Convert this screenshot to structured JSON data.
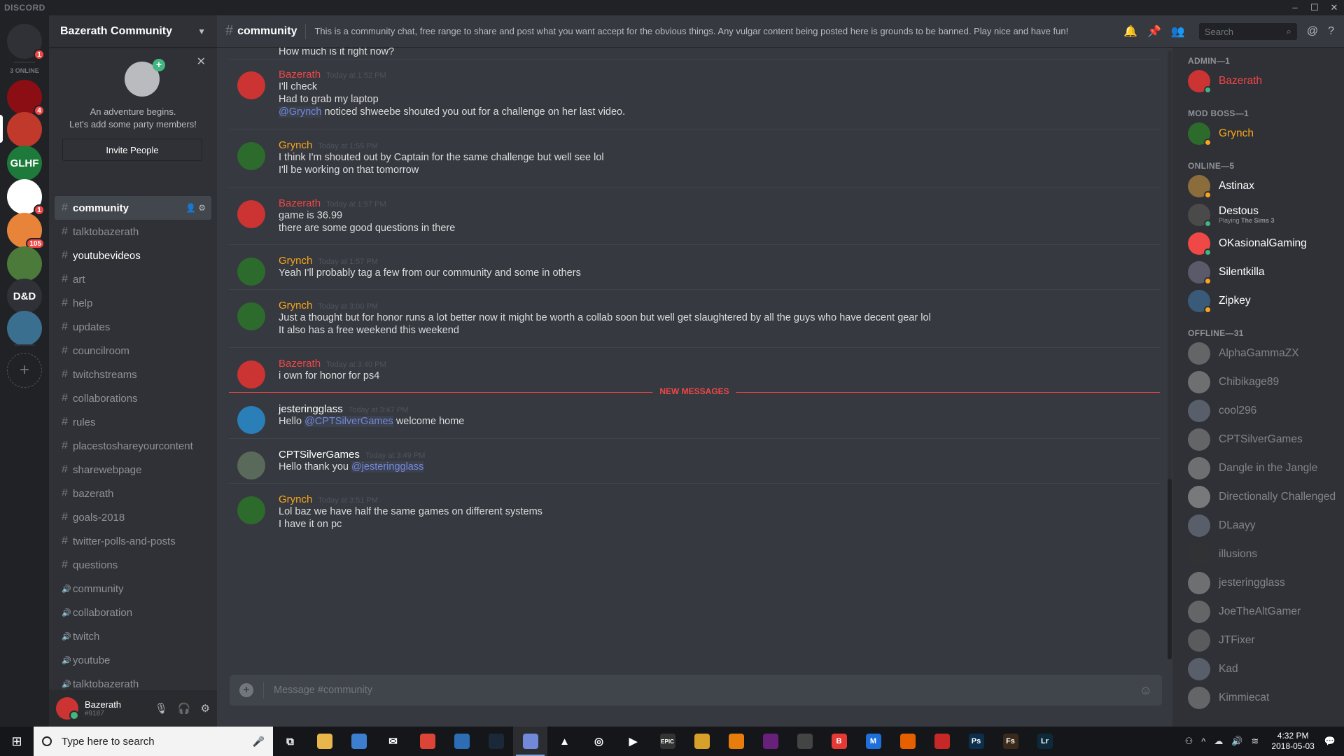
{
  "window": {
    "brand": "DISCORD"
  },
  "servers": {
    "online_count": "3 ONLINE",
    "items": [
      {
        "label": "",
        "badge": "1",
        "color": "#2f3136"
      },
      {
        "label": "",
        "badge": "4",
        "color": "#8b0e14"
      },
      {
        "label": "",
        "badge": "",
        "color": "#c0392b"
      },
      {
        "label": "GLHF",
        "badge": "",
        "color": "#1d7a3a"
      },
      {
        "label": "",
        "badge": "1",
        "color": "#ffffff"
      },
      {
        "label": "",
        "badge": "105",
        "color": "#e8843a"
      },
      {
        "label": "",
        "badge": "",
        "color": "#4c7a3a"
      },
      {
        "label": "D&D",
        "badge": "",
        "color": "#2f3136"
      },
      {
        "label": "",
        "badge": "",
        "color": "#3b6f8f"
      }
    ],
    "add_label": "+"
  },
  "guild": {
    "name": "Bazerath Community",
    "invite": {
      "line1": "An adventure begins.",
      "line2": "Let's add some party members!",
      "button": "Invite People"
    }
  },
  "channels": [
    {
      "icon": "#",
      "label": "community",
      "state": "active"
    },
    {
      "icon": "#",
      "label": "talktobazerath",
      "state": ""
    },
    {
      "icon": "#",
      "label": "youtubevideos",
      "state": "unread"
    },
    {
      "icon": "#",
      "label": "art",
      "state": ""
    },
    {
      "icon": "#",
      "label": "help",
      "state": ""
    },
    {
      "icon": "#",
      "label": "updates",
      "state": ""
    },
    {
      "icon": "#",
      "label": "councilroom",
      "state": ""
    },
    {
      "icon": "#",
      "label": "twitchstreams",
      "state": ""
    },
    {
      "icon": "#",
      "label": "collaborations",
      "state": ""
    },
    {
      "icon": "#",
      "label": "rules",
      "state": ""
    },
    {
      "icon": "#",
      "label": "placestoshareyourcontent",
      "state": ""
    },
    {
      "icon": "#",
      "label": "sharewebpage",
      "state": ""
    },
    {
      "icon": "#",
      "label": "bazerath",
      "state": ""
    },
    {
      "icon": "#",
      "label": "goals-2018",
      "state": ""
    },
    {
      "icon": "#",
      "label": "twitter-polls-and-posts",
      "state": ""
    },
    {
      "icon": "#",
      "label": "questions",
      "state": ""
    },
    {
      "icon": "🔊",
      "label": "community",
      "state": ""
    },
    {
      "icon": "🔊",
      "label": "collaboration",
      "state": ""
    },
    {
      "icon": "🔊",
      "label": "twitch",
      "state": ""
    },
    {
      "icon": "🔊",
      "label": "youtube",
      "state": ""
    },
    {
      "icon": "🔊",
      "label": "talktobazerath",
      "state": ""
    }
  ],
  "user": {
    "name": "Bazerath",
    "tag": "#9187"
  },
  "chat": {
    "channel": "community",
    "topic": "This is a community chat, free range to share and post what you want accept for the obvious things. Any vulgar content being posted here is grounds to be banned. Play nice and have fun!",
    "search_placeholder": "Search",
    "composer_placeholder": "Message #community",
    "new_messages_label": "NEW MESSAGES",
    "top_partial_line": "How much is it right now?",
    "groups": [
      {
        "author": "Bazerath",
        "color": "#f04747",
        "time": "Today at 1:52 PM",
        "avatar": "#c33",
        "lines": [
          [
            {
              "t": "I'll check"
            }
          ],
          [
            {
              "t": "Had to grab my laptop"
            }
          ],
          [
            {
              "t": "@Grynch",
              "m": true
            },
            {
              "t": " noticed shweebe shouted you out for a challenge on her last video."
            }
          ]
        ]
      },
      {
        "author": "Grynch",
        "color": "#faa61a",
        "time": "Today at 1:55 PM",
        "avatar": "#2d6b2d",
        "lines": [
          [
            {
              "t": "I think I'm shouted out by Captain for the same challenge but well see lol"
            }
          ],
          [
            {
              "t": "I'll be working on that tomorrow"
            }
          ]
        ]
      },
      {
        "author": "Bazerath",
        "color": "#f04747",
        "time": "Today at 1:57 PM",
        "avatar": "#c33",
        "lines": [
          [
            {
              "t": "game is 36.99"
            }
          ],
          [
            {
              "t": "there are some good questions in there"
            }
          ]
        ]
      },
      {
        "author": "Grynch",
        "color": "#faa61a",
        "time": "Today at 1:57 PM",
        "avatar": "#2d6b2d",
        "lines": [
          [
            {
              "t": "Yeah I'll probably tag a few from our community and some in others"
            }
          ]
        ]
      },
      {
        "author": "Grynch",
        "color": "#faa61a",
        "time": "Today at 3:00 PM",
        "avatar": "#2d6b2d",
        "lines": [
          [
            {
              "t": "Just a thought but for honor runs a lot better now it might be worth a collab soon but well get slaughtered by all the guys who have decent gear lol"
            }
          ],
          [
            {
              "t": "It also has a free weekend this weekend"
            }
          ]
        ]
      },
      {
        "author": "Bazerath",
        "color": "#f04747",
        "time": "Today at 3:40 PM",
        "avatar": "#c33",
        "lines": [
          [
            {
              "t": "i own for honor for ps4"
            }
          ]
        ]
      },
      {
        "author": "jesteringglass",
        "color": "#ffffff",
        "time": "Today at 3:47 PM",
        "avatar": "#2a7fb8",
        "lines": [
          [
            {
              "t": "Hello "
            },
            {
              "t": "@CPTSilverGames",
              "m": true
            },
            {
              "t": " welcome home"
            }
          ]
        ]
      },
      {
        "author": "CPTSilverGames",
        "color": "#ffffff",
        "time": "Today at 3:49 PM",
        "avatar": "#5a6a5a",
        "lines": [
          [
            {
              "t": "Hello thank you "
            },
            {
              "t": "@jesteringglass",
              "m": true
            }
          ]
        ]
      },
      {
        "author": "Grynch",
        "color": "#faa61a",
        "time": "Today at 3:51 PM",
        "avatar": "#2d6b2d",
        "lines": [
          [
            {
              "t": "Lol baz we have half the same games on different systems"
            }
          ],
          [
            {
              "t": "I have it on pc"
            }
          ]
        ]
      }
    ]
  },
  "members": {
    "categories": [
      {
        "title": "ADMIN—1",
        "members": [
          {
            "name": "Bazerath",
            "color": "#f04747",
            "avatar": "#c33",
            "status": "#43b581"
          }
        ]
      },
      {
        "title": "MOD BOSS—1",
        "members": [
          {
            "name": "Grynch",
            "color": "#faa61a",
            "avatar": "#2d6b2d",
            "status": "#faa61a"
          }
        ]
      },
      {
        "title": "ONLINE—5",
        "members": [
          {
            "name": "Astinax",
            "color": "#ffffff",
            "avatar": "#8a6d3b",
            "status": "#faa61a"
          },
          {
            "name": "Destous",
            "color": "#ffffff",
            "avatar": "#4a4a4a",
            "status": "#43b581",
            "activity_prefix": "Playing ",
            "activity": "The Sims 3"
          },
          {
            "name": "OKasionalGaming",
            "color": "#ffffff",
            "avatar": "#f04747",
            "status": "#43b581"
          },
          {
            "name": "Silentkilla",
            "color": "#ffffff",
            "avatar": "#5a5a6a",
            "status": "#faa61a"
          },
          {
            "name": "Zipkey",
            "color": "#ffffff",
            "avatar": "#3a5a7a",
            "status": "#faa61a"
          }
        ]
      },
      {
        "title": "OFFLINE—31",
        "members": [
          {
            "name": "AlphaGammaZX",
            "color": "#b9bbbe",
            "avatar": "#888"
          },
          {
            "name": "Chibikage89",
            "color": "#b9bbbe",
            "avatar": "#999"
          },
          {
            "name": "cool296",
            "color": "#b9bbbe",
            "avatar": "#747f8d"
          },
          {
            "name": "CPTSilverGames",
            "color": "#b9bbbe",
            "avatar": "#888"
          },
          {
            "name": "Dangle in the Jangle",
            "color": "#b9bbbe",
            "avatar": "#999"
          },
          {
            "name": "Directionally Challenged",
            "color": "#b9bbbe",
            "avatar": "#aaa"
          },
          {
            "name": "DLaayy",
            "color": "#b9bbbe",
            "avatar": "#747f8d"
          },
          {
            "name": "illusions",
            "color": "#b9bbbe",
            "avatar": "#333"
          },
          {
            "name": "jesteringglass",
            "color": "#b9bbbe",
            "avatar": "#999"
          },
          {
            "name": "JoeTheAltGamer",
            "color": "#b9bbbe",
            "avatar": "#888"
          },
          {
            "name": "JTFixer",
            "color": "#b9bbbe",
            "avatar": "#777"
          },
          {
            "name": "Kad",
            "color": "#b9bbbe",
            "avatar": "#747f8d"
          },
          {
            "name": "Kimmiecat",
            "color": "#b9bbbe",
            "avatar": "#888"
          }
        ]
      }
    ]
  },
  "taskbar": {
    "search_placeholder": "Type here to search",
    "time": "4:32 PM",
    "date": "2018-05-03",
    "apps": [
      {
        "name": "task-view",
        "glyph": "⧉",
        "color": "transparent"
      },
      {
        "name": "file-explorer",
        "glyph": "",
        "color": "#e8b64a"
      },
      {
        "name": "store",
        "glyph": "",
        "color": "#3c7fd1"
      },
      {
        "name": "mail",
        "glyph": "✉",
        "color": "transparent"
      },
      {
        "name": "chrome",
        "glyph": "",
        "color": "#db4437"
      },
      {
        "name": "app-blue",
        "glyph": "",
        "color": "#2d6db5"
      },
      {
        "name": "steam",
        "glyph": "",
        "color": "#1b2838"
      },
      {
        "name": "discord",
        "glyph": "",
        "color": "#7289da",
        "active": true
      },
      {
        "name": "vlc",
        "glyph": "▲",
        "color": "transparent"
      },
      {
        "name": "obs",
        "glyph": "◎",
        "color": "transparent"
      },
      {
        "name": "media-player",
        "glyph": "▶",
        "color": "transparent"
      },
      {
        "name": "epic-games",
        "glyph": "EPIC",
        "color": "#333"
      },
      {
        "name": "game-app",
        "glyph": "",
        "color": "#d6a02a"
      },
      {
        "name": "blender",
        "glyph": "",
        "color": "#e87d0d"
      },
      {
        "name": "visual-studio",
        "glyph": "",
        "color": "#68217a"
      },
      {
        "name": "unity",
        "glyph": "",
        "color": "#444"
      },
      {
        "name": "app-b",
        "glyph": "B",
        "color": "#e53935"
      },
      {
        "name": "malwarebytes",
        "glyph": "M",
        "color": "#1e6fd9"
      },
      {
        "name": "firefox",
        "glyph": "",
        "color": "#e66000"
      },
      {
        "name": "app-red",
        "glyph": "",
        "color": "#c62828"
      },
      {
        "name": "photoshop",
        "glyph": "Ps",
        "color": "#0b2f4d"
      },
      {
        "name": "fuse",
        "glyph": "Fs",
        "color": "#3a2a1a"
      },
      {
        "name": "lightroom",
        "glyph": "Lr",
        "color": "#0d2a3a"
      }
    ]
  }
}
